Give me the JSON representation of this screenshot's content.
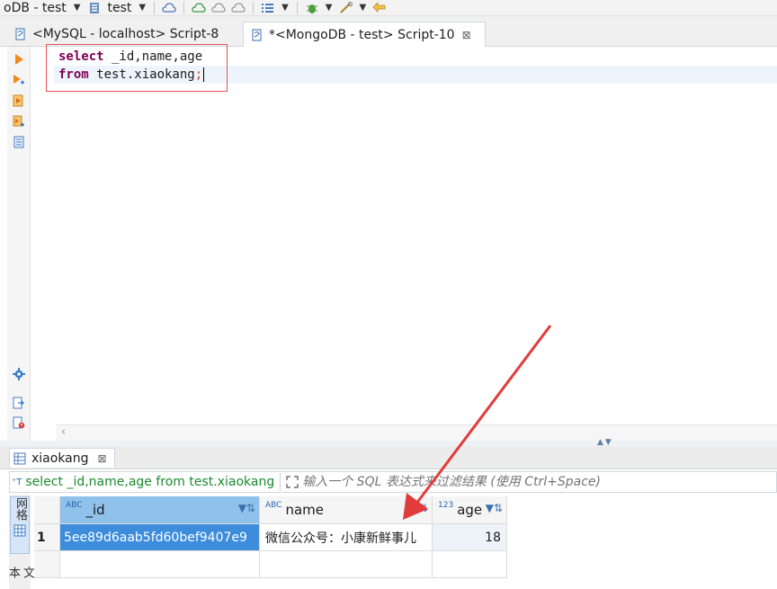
{
  "toolbar": {
    "connection_label": "oDB - test",
    "schema_label": "test"
  },
  "tabs": [
    {
      "label": "<MySQL - localhost> Script-8",
      "active": false
    },
    {
      "label": "*<MongoDB - test> Script-10",
      "active": true,
      "close": "⊠"
    }
  ],
  "editor": {
    "line1_kw": "select",
    "line1_rest": " _id,name,age",
    "line2_kw": "from",
    "line2_rest": " test.xiaokang",
    "line2_semicolon": ";"
  },
  "results": {
    "tab_label": "xiaokang",
    "tab_close": "⊠",
    "filter_sql": "select _id,name,age from test.xiaokang",
    "filter_placeholder": "输入一个 SQL 表达式来过滤结果 (使用 Ctrl+Space)",
    "side_tab_grid": "网格",
    "side_tab_text": "文本",
    "columns": [
      {
        "type_badge": "ABC",
        "name": "_id"
      },
      {
        "type_badge": "ABC",
        "name": "name"
      },
      {
        "type_badge": "123",
        "name": "age"
      }
    ],
    "rows": [
      {
        "num": "1",
        "_id": "5ee89d6aab5fd60bef9407e9",
        "name": "微信公众号：小康新鲜事儿",
        "age": "18"
      }
    ]
  },
  "colors": {
    "keyword": "#7f0055",
    "annotation_red": "#e25454",
    "selection_blue": "#3d8ddc",
    "filter_green": "#1c8a30"
  }
}
